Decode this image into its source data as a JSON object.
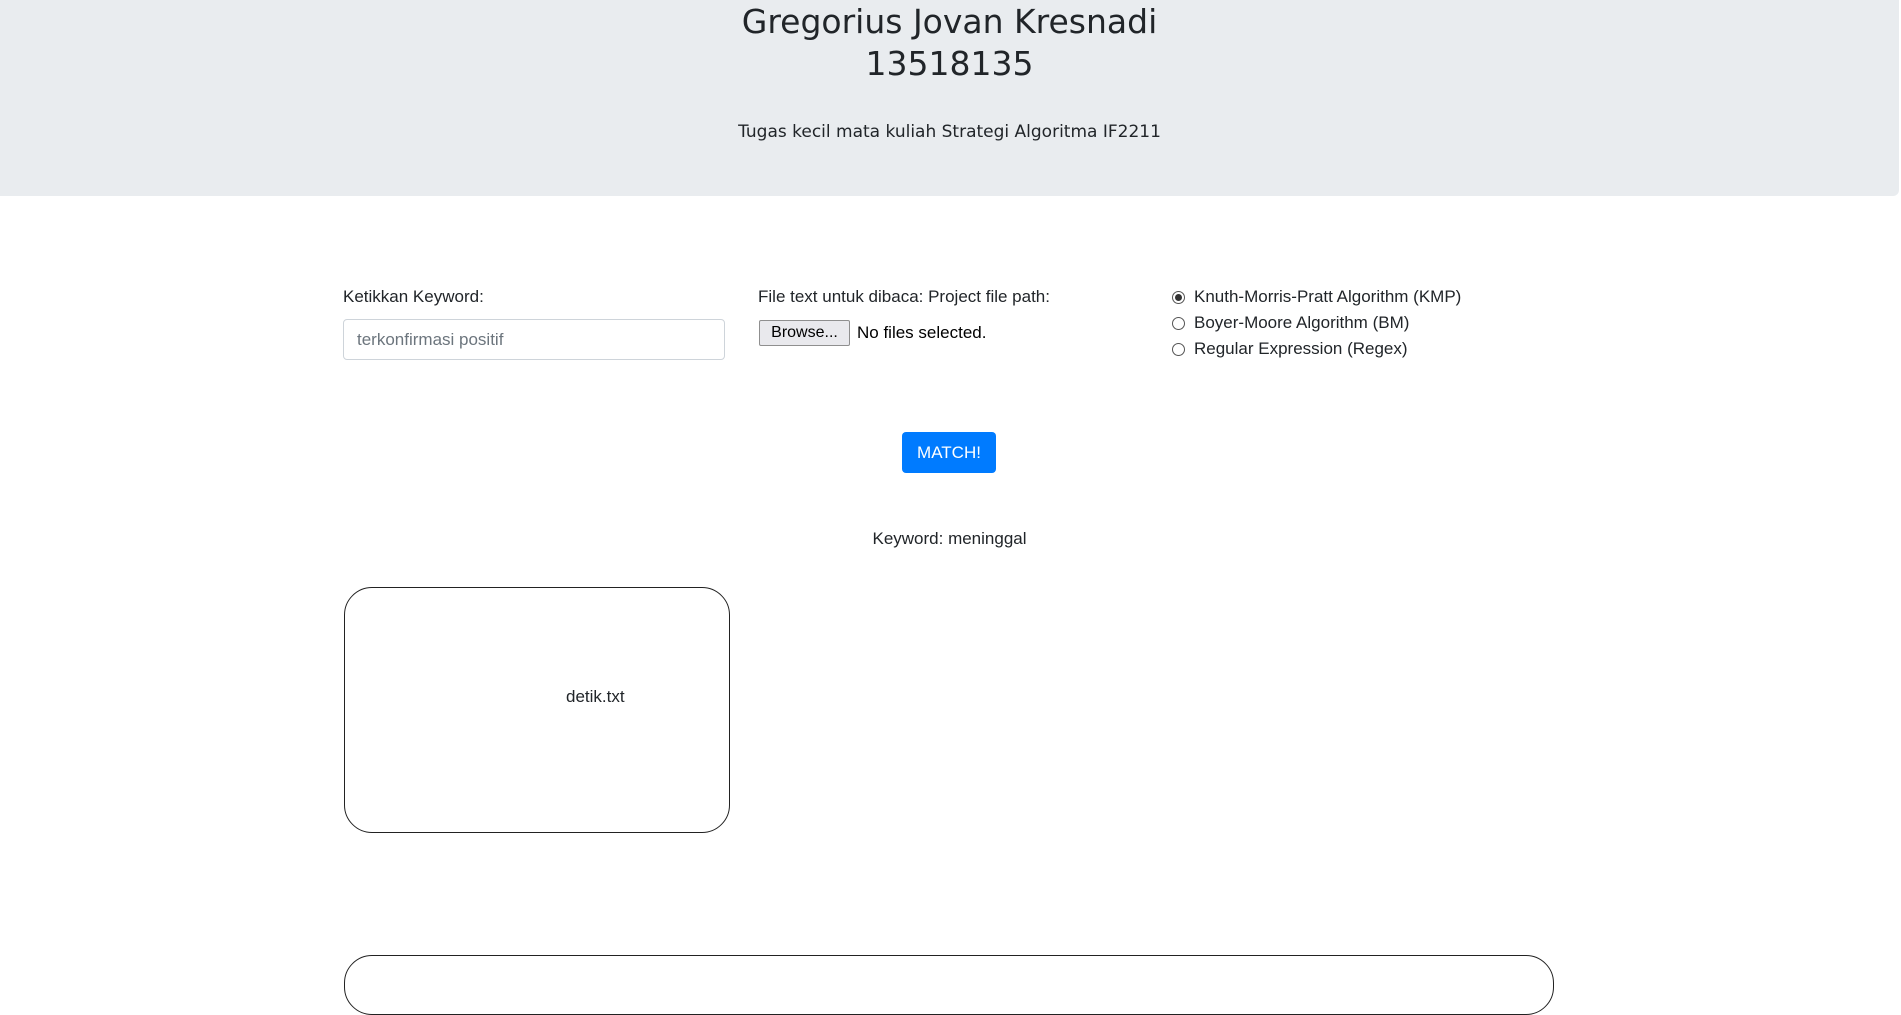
{
  "header": {
    "name": "Gregorius Jovan Kresnadi",
    "student_id": "13518135",
    "subtitle": "Tugas kecil mata kuliah Strategi Algoritma IF2211"
  },
  "form": {
    "keyword_label": "Ketikkan Keyword:",
    "keyword_placeholder": "terkonfirmasi positif",
    "file_label": "File text untuk dibaca: Project file path:",
    "browse_label": "Browse...",
    "file_status": "No files selected.",
    "algorithms": [
      {
        "label": "Knuth-Morris-Pratt Algorithm (KMP)",
        "selected": true
      },
      {
        "label": "Boyer-Moore Algorithm (BM)",
        "selected": false
      },
      {
        "label": "Regular Expression (Regex)",
        "selected": false
      }
    ],
    "match_label": "MATCH!"
  },
  "result": {
    "keyword_line": "Keyword: meninggal",
    "cards": [
      {
        "file": "detik.txt"
      }
    ]
  }
}
